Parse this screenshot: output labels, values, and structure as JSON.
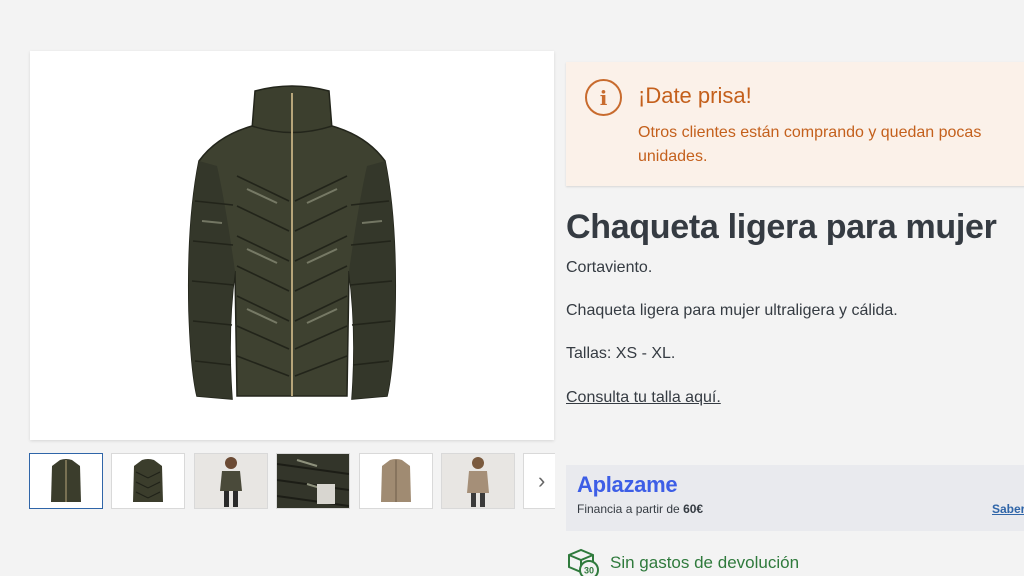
{
  "product": {
    "title": "Chaqueta ligera para mujer",
    "subtitle": "Cortaviento.",
    "description": "Chaqueta ligera para mujer ultraligera y cálida.",
    "sizes": "Tallas: XS - XL.",
    "size_guide_link": "Consulta tu talla aquí."
  },
  "alert": {
    "icon": "info-icon",
    "title": "¡Date prisa!",
    "text": "Otros clientes están comprando y quedan pocas unidades."
  },
  "gallery": {
    "thumbnails": [
      {
        "name": "thumbnail-1",
        "color": "#3b3d2c"
      },
      {
        "name": "thumbnail-2",
        "color": "#3b3d2c"
      },
      {
        "name": "thumbnail-3",
        "color": "#4a4a3a"
      },
      {
        "name": "thumbnail-4",
        "color": "#33352a"
      },
      {
        "name": "thumbnail-5",
        "color": "#a08b72"
      },
      {
        "name": "thumbnail-6",
        "color": "#a58f78"
      }
    ],
    "next_icon": "chevron-right-icon"
  },
  "financing": {
    "brand": "Aplazame",
    "text_prefix": "Financia a partir de",
    "amount": "60€",
    "link": "Saber"
  },
  "returns": {
    "icon": "box-30-icon",
    "label": "Sin gastos de devolución",
    "icon_number": "30"
  },
  "colors": {
    "alert_bg": "#fbf1e9",
    "alert_text": "#c4601c",
    "brand_blue": "#3d5ee6",
    "link_blue": "#2f65a8",
    "returns_green": "#2f7a3c"
  }
}
